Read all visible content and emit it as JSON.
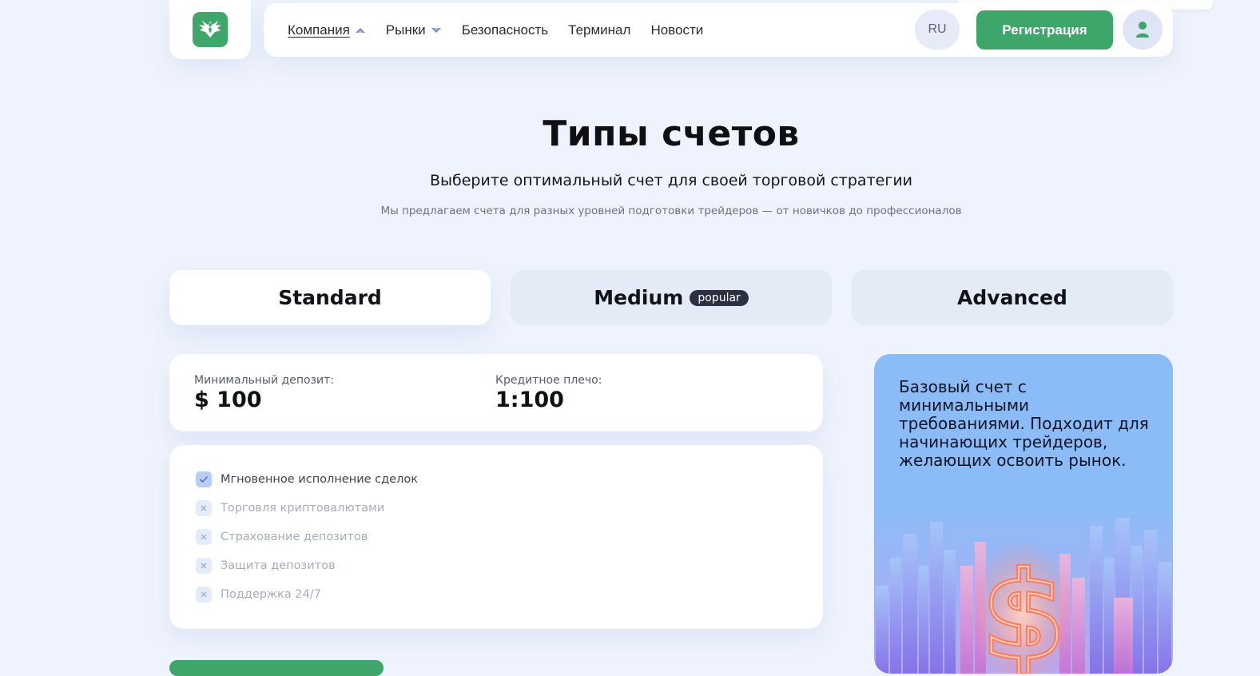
{
  "nav": {
    "items": [
      {
        "label": "Компания",
        "active": true,
        "dropdown": true,
        "chevron_icon": "chevron-up-icon"
      },
      {
        "label": "Рынки",
        "active": false,
        "dropdown": true,
        "chevron_icon": "chevron-down-icon"
      },
      {
        "label": "Безопасность",
        "active": false,
        "dropdown": false
      },
      {
        "label": "Терминал",
        "active": false,
        "dropdown": false
      },
      {
        "label": "Новости",
        "active": false,
        "dropdown": false
      }
    ],
    "lang": "RU",
    "register_label": "Регистрация",
    "logo_icon": "eagle-logo-icon",
    "avatar_icon": "user-icon"
  },
  "page": {
    "title": "Типы счетов",
    "subtitle": "Выберите оптимальный счет для своей торговой стратегии",
    "description": "Мы предлагаем счета для разных уровней подготовки трейдеров — от новичков до профессионалов"
  },
  "tabs": [
    {
      "label": "Standard",
      "selected": true,
      "badge": ""
    },
    {
      "label": "Medium",
      "selected": false,
      "badge": "popular"
    },
    {
      "label": "Advanced",
      "selected": false,
      "badge": ""
    }
  ],
  "params": {
    "deposit_label": "Минимальный депозит:",
    "deposit_value": "$ 100",
    "leverage_label": "Кредитное плечо:",
    "leverage_value": "1:100"
  },
  "features": [
    {
      "label": "Мгновенное исполнение сделок",
      "enabled": true
    },
    {
      "label": "Торговля криптовалютами",
      "enabled": false
    },
    {
      "label": "Страхование депозитов",
      "enabled": false
    },
    {
      "label": "Защита депозитов",
      "enabled": false
    },
    {
      "label": "Поддержка 24/7",
      "enabled": false
    }
  ],
  "promo": {
    "text": "Базовый счет с минимальными требованиями. Подходит для начинающих трейдеров, желающих освоить рынок.",
    "image_icon": "city-dollar-illustration"
  },
  "colors": {
    "brand_green": "#3ea66a",
    "background": "#eff3fd",
    "promo_blue": "#8cbcf7",
    "badge_dark": "#2d3042"
  }
}
